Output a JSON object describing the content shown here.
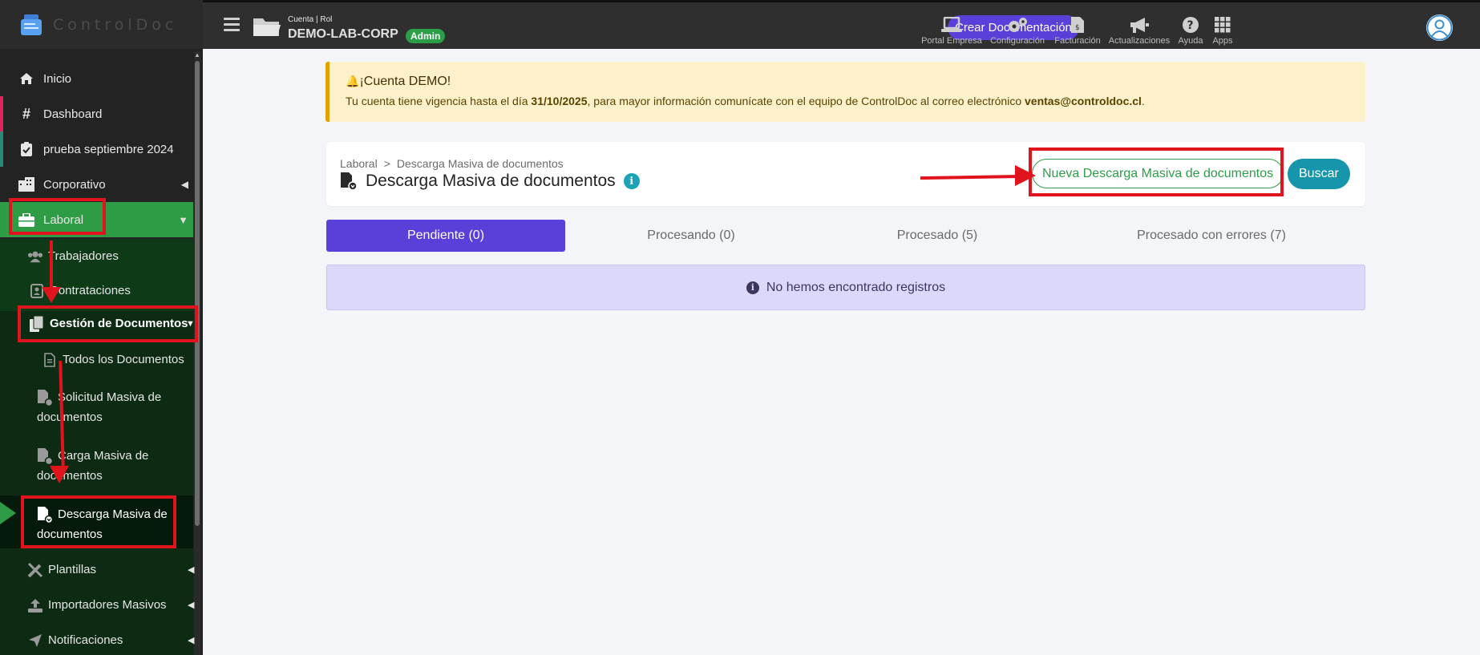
{
  "app": {
    "name": "ControlDoc"
  },
  "topbar": {
    "account_label": "Cuenta | Rol",
    "account_name": "DEMO-LAB-CORP",
    "role_badge": "Admin",
    "create_button": "Crear Documentación",
    "items": [
      {
        "label": "Portal Empresa",
        "icon": "laptop-icon"
      },
      {
        "label": "Configuración",
        "icon": "gears-icon"
      },
      {
        "label": "Facturación",
        "icon": "invoice-icon"
      },
      {
        "label": "Actualizaciones",
        "icon": "megaphone-icon"
      },
      {
        "label": "Ayuda",
        "icon": "help-icon"
      },
      {
        "label": "Apps",
        "icon": "grid-icon"
      }
    ]
  },
  "sidebar": {
    "items": [
      {
        "label": "Inicio",
        "icon": "home-icon",
        "accent": ""
      },
      {
        "label": "Dashboard",
        "icon": "hashtag-icon",
        "accent": "#e0245e"
      },
      {
        "label": "prueba septiembre 2024",
        "icon": "clipboard-check-icon",
        "accent": "#2a8a7a"
      },
      {
        "label": "Corporativo",
        "icon": "building-icon",
        "accent": ""
      },
      {
        "label": "Laboral",
        "icon": "briefcase-icon",
        "accent": ""
      }
    ],
    "sub_items": [
      {
        "label": "Trabajadores",
        "icon": "users-icon"
      },
      {
        "label": "Contrataciones",
        "icon": "contract-icon"
      },
      {
        "label": "Gestión de Documentos",
        "icon": "documents-icon"
      },
      {
        "label": "Todos los Documentos",
        "icon": "file-icon"
      },
      {
        "label": "Solicitud Masiva de documentos",
        "icon": "file-request-icon"
      },
      {
        "label": "Carga Masiva de documentos",
        "icon": "file-upload-icon"
      },
      {
        "label": "Descarga Masiva de documentos",
        "icon": "file-download-icon"
      },
      {
        "label": "Plantillas",
        "icon": "tools-icon"
      },
      {
        "label": "Importadores Masivos",
        "icon": "upload-icon"
      },
      {
        "label": "Notificaciones",
        "icon": "paper-plane-icon"
      }
    ]
  },
  "alert": {
    "title": "¡Cuenta DEMO!",
    "text_before": "Tu cuenta tiene vigencia hasta el día ",
    "date": "31/10/2025",
    "text_middle": ", para mayor información comunícate con el equipo de ControlDoc al correo electrónico ",
    "email": "ventas@controldoc.cl",
    "text_after": "."
  },
  "header": {
    "breadcrumb": [
      "Laboral",
      "Descarga Masiva de documentos"
    ],
    "breadcrumb_sep": ">",
    "title": "Descarga Masiva de documentos",
    "info_icon": "i",
    "new_button": "Nueva Descarga Masiva de documentos",
    "search_button": "Buscar"
  },
  "tabs": [
    {
      "label": "Pendiente (0)",
      "active": true
    },
    {
      "label": "Procesando (0)",
      "active": false
    },
    {
      "label": "Procesado (5)",
      "active": false
    },
    {
      "label": "Procesado con errores (7)",
      "active": false
    }
  ],
  "empty_message": "No hemos encontrado registros",
  "colors": {
    "primary": "#5b3fd9",
    "success": "#2e9c44",
    "info": "#1796ab",
    "annotation": "#e0141c"
  }
}
